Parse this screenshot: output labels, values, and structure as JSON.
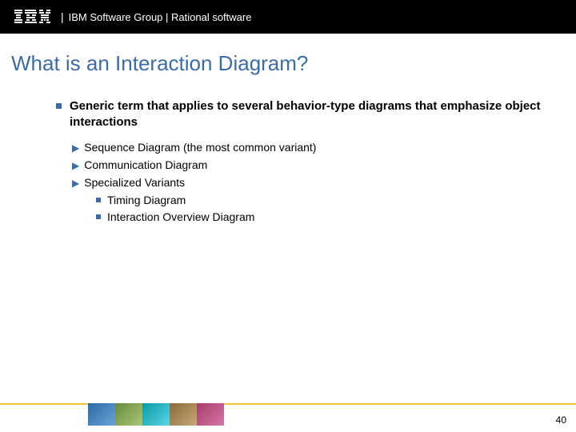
{
  "header": {
    "logo_text": "IBM",
    "group_text": "IBM Software Group | Rational software"
  },
  "title": "What is an Interaction Diagram?",
  "main_bullet": "Generic term that applies to several behavior-type diagrams that emphasize object interactions",
  "sub_items": [
    "Sequence Diagram (the most common variant)",
    "Communication Diagram",
    "Specialized Variants"
  ],
  "subsub_items": [
    "Timing Diagram",
    "Interaction Overview Diagram"
  ],
  "page_number": "40"
}
